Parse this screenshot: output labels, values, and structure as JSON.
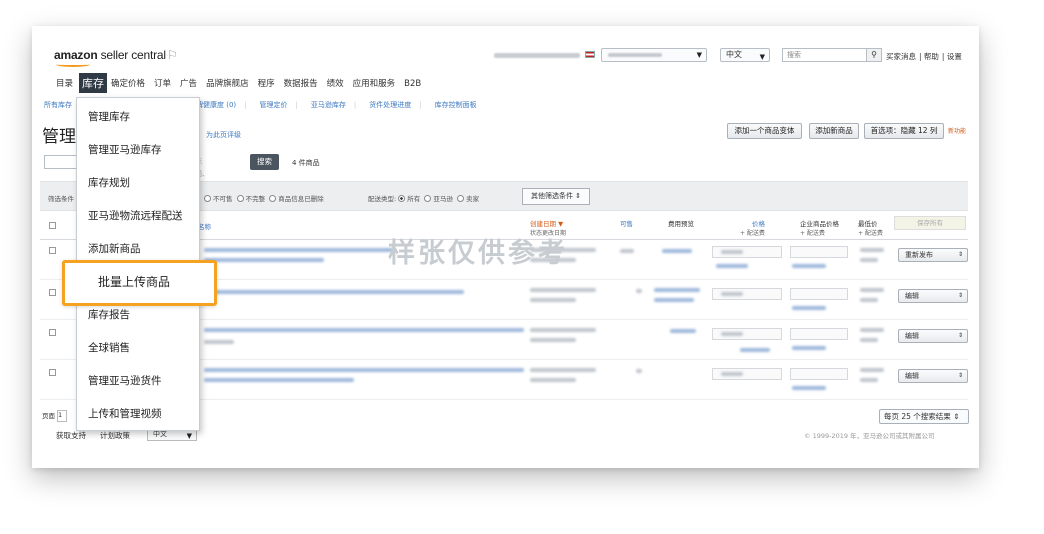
{
  "logo": {
    "brand": "amazon",
    "product": "seller central"
  },
  "header": {
    "language": "中文",
    "search_placeholder": "搜索",
    "links": [
      "买家消息",
      "帮助",
      "设置"
    ]
  },
  "mainnav": {
    "items": [
      "目录",
      "库存",
      "确定价格",
      "订单",
      "广告",
      "品牌旗舰店",
      "程序",
      "数据报告",
      "绩效",
      "应用和服务",
      "B2B"
    ],
    "active": "库存"
  },
  "subnav": {
    "items": [
      "所有库存",
      "品牌健康度 (0)",
      "管理定价",
      "亚马逊库存",
      "货件处理进度",
      "库存控制面板"
    ]
  },
  "page": {
    "title": "管理",
    "perf_link": "为此页评级",
    "btn_add_variation": "添加一个商品变体",
    "btn_add_product": "添加新商品",
    "btn_preferences": "首选项：隐藏 12 列",
    "new_feature": "新功能",
    "search_placeholder_tail": "标题、ISBN",
    "search_button": "搜索",
    "result_count": "4 件商品"
  },
  "filters": {
    "label": "筛选条件",
    "status_options": [
      "不可售",
      "不完整",
      "商品信息已删除"
    ],
    "fulfillment_label": "配送类型:",
    "fulfillment_options": [
      "所有",
      "亚马逊",
      "卖家"
    ],
    "fulfillment_selected": "所有",
    "more_filters": "其他筛选条件"
  },
  "table": {
    "headers": {
      "name": "名称",
      "date": "创建日期",
      "date_sub": "状态更改日期",
      "available": "可售",
      "fee": "费用预览",
      "price": "价格",
      "price_sub": "+ 配送费",
      "business_price": "企业商品价格",
      "business_price_sub": "+ 配送费",
      "lowest_price": "最低价",
      "lowest_price_sub": "+ 配送费"
    },
    "save_all": "保存所有",
    "row_actions": [
      "重新发布",
      "编辑",
      "编辑",
      "编辑"
    ]
  },
  "watermark": "样张仅供参考",
  "footer": {
    "page_label": "页面",
    "page_value": "1",
    "per_page": "每页 25 个搜索结果",
    "support": "获取支持",
    "policy": "计划政策",
    "language": "中文",
    "copyright": "© 1999-2019 年，亚马逊公司或其附属公司"
  },
  "dropdown": {
    "items": [
      "管理库存",
      "管理亚马逊库存",
      "库存规划",
      "亚马逊物流远程配送",
      "添加新商品",
      "批量上传商品",
      "库存报告",
      "全球销售",
      "管理亚马逊货件",
      "上传和管理视频"
    ],
    "highlighted": "批量上传商品"
  },
  "colors": {
    "highlight": "#f4a21f",
    "nav_active": "#2f3a45",
    "link": "#3b78c2",
    "sort": "#d35b1a"
  }
}
